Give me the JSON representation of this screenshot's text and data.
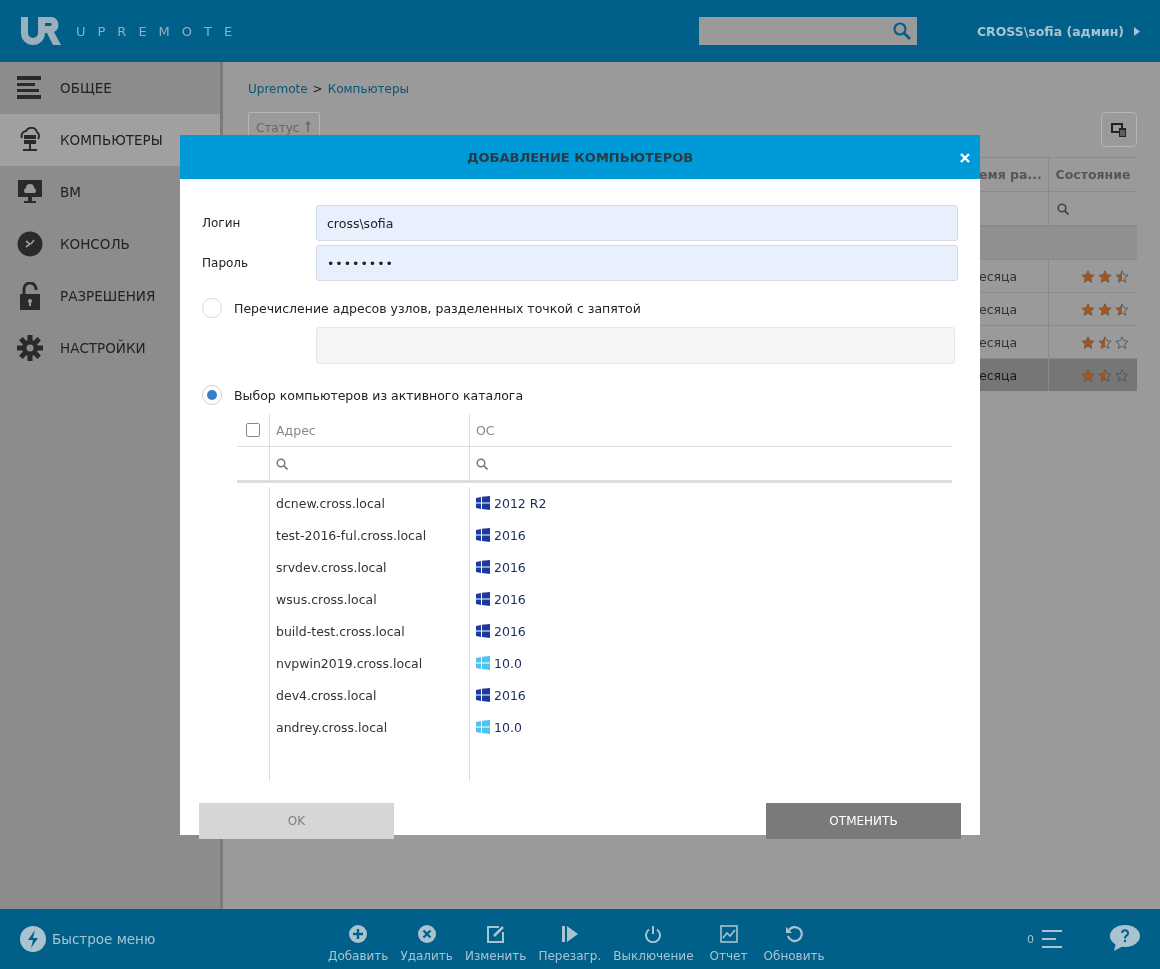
{
  "header": {
    "logo_text": "UPREMOTE",
    "user": "CROSS\\sofia (админ)"
  },
  "sidebar": {
    "items": [
      {
        "label": "ОБЩЕЕ",
        "selected": false
      },
      {
        "label": "КОМПЬЮТЕРЫ",
        "selected": true
      },
      {
        "label": "ВМ",
        "selected": false
      },
      {
        "label": "КОНСОЛЬ",
        "selected": false
      },
      {
        "label": "РАЗРЕШЕНИЯ",
        "selected": false
      },
      {
        "label": "НАСТРОЙКИ",
        "selected": false
      }
    ]
  },
  "breadcrumb": {
    "items": [
      "Upremote",
      "Компьютеры"
    ],
    "separator": ">"
  },
  "background_table": {
    "sort_button": "Статус",
    "columns": [
      "емя ра...",
      "Состояние"
    ],
    "rows": [
      {
        "cell": "есяца",
        "stars": 2.5,
        "selected": false
      },
      {
        "cell": "есяца",
        "stars": 2.5,
        "selected": false
      },
      {
        "cell": "есяца",
        "stars": 1.5,
        "selected": false
      },
      {
        "cell": "есяца",
        "stars": 1.5,
        "selected": true
      }
    ]
  },
  "dialog": {
    "title": "ДОБАВЛЕНИЕ КОМПЬЮТЕРОВ",
    "login": {
      "label": "Логин",
      "value": "cross\\sofia"
    },
    "password": {
      "label": "Пароль",
      "value": "••••••••"
    },
    "options": [
      {
        "label": "Перечисление адресов узлов, разделенных точкой с запятой",
        "selected": false
      },
      {
        "label": "Выбор компьютеров из активного каталога",
        "selected": true
      }
    ],
    "table": {
      "select_all_checked": false,
      "columns": [
        "Адрес",
        "ОС"
      ],
      "rows": [
        {
          "address": "dcnew.cross.local",
          "os": "2012 R2",
          "kind": "server"
        },
        {
          "address": "test-2016-ful.cross.local",
          "os": "2016",
          "kind": "server"
        },
        {
          "address": "srvdev.cross.local",
          "os": "2016",
          "kind": "server"
        },
        {
          "address": "wsus.cross.local",
          "os": "2016",
          "kind": "server"
        },
        {
          "address": "build-test.cross.local",
          "os": "2016",
          "kind": "server"
        },
        {
          "address": "nvpwin2019.cross.local",
          "os": "10.0",
          "kind": "desktop"
        },
        {
          "address": "dev4.cross.local",
          "os": "2016",
          "kind": "server"
        },
        {
          "address": "andrey.cross.local",
          "os": "10.0",
          "kind": "desktop"
        }
      ]
    },
    "ok": {
      "label": "OK",
      "disabled": true
    },
    "cancel": {
      "label": "ОТМЕНИТЬ",
      "disabled": false
    }
  },
  "bottom_bar": {
    "quick_menu": "Быстрое меню",
    "actions": [
      "Добавить",
      "Удалить",
      "Изменить",
      "Перезагр.",
      "Выключение",
      "Отчет",
      "Обновить"
    ],
    "queue_count": "0"
  }
}
